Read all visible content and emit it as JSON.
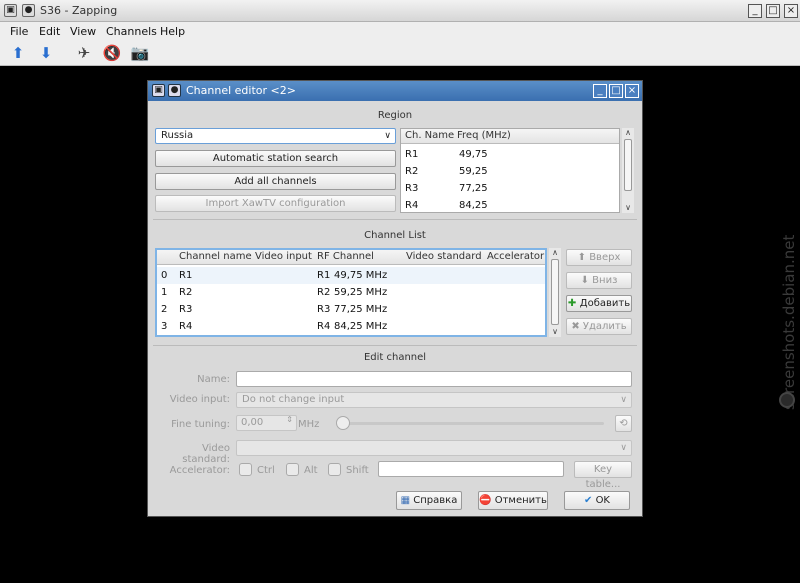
{
  "app": {
    "title": "S36 - Zapping",
    "menu": [
      "File",
      "Edit",
      "View",
      "Channels",
      "Help"
    ]
  },
  "watermark": "screenshots.debian.net",
  "dialog": {
    "title": "Channel editor <2>",
    "region": {
      "title": "Region",
      "selected": "Russia",
      "buttons": {
        "auto_search": "Automatic station search",
        "add_all": "Add all channels",
        "import_xawtv": "Import XawTV configuration"
      },
      "table": {
        "headers": [
          "Ch. Name",
          "Freq (MHz)"
        ],
        "rows": [
          [
            "R1",
            "49,75"
          ],
          [
            "R2",
            "59,25"
          ],
          [
            "R3",
            "77,25"
          ],
          [
            "R4",
            "84,25"
          ]
        ]
      }
    },
    "channel_list": {
      "title": "Channel List",
      "headers": [
        "Channel name",
        "Video input",
        "RF Channel",
        "Video standard",
        "Accelerator"
      ],
      "rows": [
        [
          "0",
          "R1",
          "R1",
          "49,75 MHz"
        ],
        [
          "1",
          "R2",
          "R2",
          "59,25 MHz"
        ],
        [
          "2",
          "R3",
          "R3",
          "77,25 MHz"
        ],
        [
          "3",
          "R4",
          "R4",
          "84,25 MHz"
        ]
      ],
      "buttons": {
        "up": "Вверх",
        "down": "Вниз",
        "add": "Добавить",
        "remove": "Удалить"
      }
    },
    "edit_channel": {
      "title": "Edit channel",
      "name_label": "Name:",
      "video_input_label": "Video input:",
      "video_input_value": "Do not change input",
      "fine_tuning_label": "Fine tuning:",
      "fine_tuning_value": "0,00",
      "fine_tuning_unit": "MHz",
      "video_standard_label": "Video standard:",
      "accelerator_label": "Accelerator:",
      "ctrl": "Ctrl",
      "alt": "Alt",
      "shift": "Shift",
      "key_table": "Key table..."
    },
    "footer": {
      "help": "Справка",
      "cancel": "Отменить",
      "ok": "OK"
    }
  }
}
